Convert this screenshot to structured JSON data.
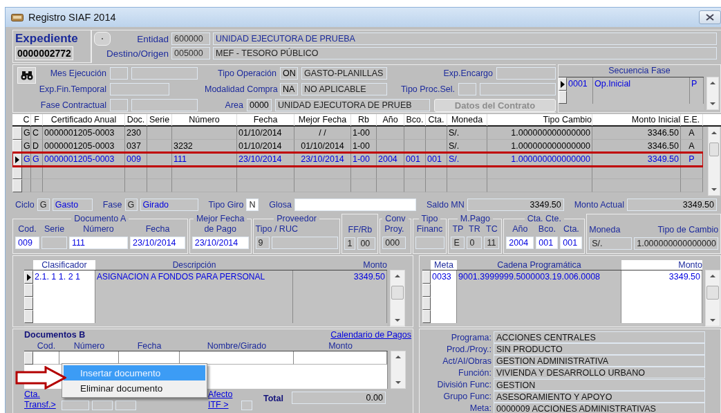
{
  "window": {
    "title": "Registro SIAF 2014"
  },
  "expediente": {
    "label": "Expediente",
    "number": "0000002772"
  },
  "header_fields": [
    {
      "label": "Entidad",
      "code": "600000",
      "value": "UNIDAD EJECUTORA DE PRUEBA"
    },
    {
      "label": "Destino/Origen",
      "code": "005000",
      "value": "MEF - TESORO PÚBLICO"
    }
  ],
  "filter_rows": [
    [
      {
        "kind": "pair",
        "label": "Mes Ejecución"
      },
      {
        "kind": "pair",
        "label": "Tipo Operación",
        "code": "ON",
        "value": "GASTO-PLANILLAS"
      },
      {
        "kind": "single",
        "label": "Exp.Encargo"
      }
    ],
    [
      {
        "kind": "single",
        "label": "Exp.Fin.Temporal"
      },
      {
        "kind": "pair",
        "label": "Modalidad Compra",
        "code": "NA",
        "value": "NO APLICABLE"
      },
      {
        "kind": "pair",
        "label": "Tipo Proc.Sel."
      }
    ],
    [
      {
        "kind": "pair",
        "label": "Fase Contractual"
      },
      {
        "kind": "pair",
        "label": "Area",
        "code": "0000",
        "value": "UNIDAD EJECUTORA DE PRUEB"
      },
      {
        "kind": "button",
        "label": "Datos del Contrato",
        "disabled": true
      }
    ]
  ],
  "fase_sequence": {
    "title": "Secuencia Fase",
    "rows": [
      {
        "cells": [
          "0001",
          "Op.Inicial",
          "P"
        ],
        "selected": true
      }
    ]
  },
  "table": {
    "columns": [
      "C",
      "F",
      "Certificado Anual",
      "Doc.",
      "Serie",
      "Número",
      "Fecha",
      "Mejor Fecha",
      "Rb",
      "Año",
      "Bco.",
      "Cta.",
      "Moneda",
      "Tipo Cambio",
      "Monto Inicial",
      "E.E."
    ],
    "rows": [
      {
        "cells": [
          "G",
          "C",
          "0000001205-0003",
          "230",
          null,
          null,
          "01/10/2014",
          "/ /",
          "1-00",
          null,
          null,
          null,
          "S/.",
          "1.000000000000000",
          "3346.50",
          "A"
        ],
        "selected": false,
        "highlighted": false
      },
      {
        "cells": [
          "G",
          "D",
          "0000001205-0003",
          "037",
          null,
          "3232",
          "01/10/2014",
          "01/10/2014",
          "1-00",
          null,
          null,
          null,
          "S/.",
          "1.000000000000000",
          "3346.50",
          "A"
        ],
        "selected": false,
        "highlighted": false
      },
      {
        "cells": [
          "G",
          "G",
          "0000001205-0003",
          "009",
          null,
          "111",
          "23/10/2014",
          "23/10/2014",
          "1-00",
          "2004",
          "001",
          "001",
          "S/.",
          "1.000000000000000",
          "3349.50",
          "P"
        ],
        "selected": true,
        "highlighted": true
      }
    ]
  },
  "cycle_fields": [
    {
      "label": "Ciclo",
      "fields": [
        {
          "value": "G",
          "editable": false
        },
        {
          "value": "Gasto",
          "editable": false
        }
      ]
    },
    {
      "label": "Fase",
      "fields": [
        {
          "value": "G",
          "editable": false
        },
        {
          "value": "Girado",
          "editable": false
        }
      ]
    },
    {
      "label": "Tipo Giro",
      "fields": [
        {
          "value": "N",
          "editable": true
        }
      ]
    },
    {
      "label": "Glosa",
      "fields": [
        {
          "editable": true
        }
      ]
    },
    {
      "label": "Saldo MN",
      "fields": [
        {
          "value": "3349.50",
          "editable": false
        }
      ]
    },
    {
      "label": "Monto Actual",
      "fields": [
        {
          "value": "3349.50",
          "editable": false
        }
      ]
    }
  ],
  "groups": [
    {
      "legend": "Documento A",
      "labels": [
        "Cod.",
        "Serie",
        "Número",
        "Fecha"
      ],
      "fields": [
        {
          "value": "009",
          "editable": true
        },
        {
          "editable": false
        },
        {
          "value": "111",
          "editable": true
        },
        {
          "value": "23/10/2014",
          "editable": true
        }
      ]
    },
    {
      "legend": "Mejor Fecha",
      "labels": [
        "de Pago"
      ],
      "fields": [
        {
          "value": "23/10/2014",
          "editable": true
        }
      ]
    },
    {
      "legend": "Proveedor",
      "labels": [
        "Tipo / RUC"
      ],
      "fields": [
        {
          "value": "9",
          "editable": false
        },
        {
          "editable": false
        }
      ]
    },
    {
      "labels": [
        "FF/Rb"
      ],
      "fields": [
        {
          "value": "1",
          "editable": false
        },
        {
          "value": "00",
          "editable": false
        }
      ]
    },
    {
      "legend": "Conv",
      "labels": [
        "Proy."
      ],
      "fields": [
        {
          "value": "000",
          "editable": false
        }
      ]
    },
    {
      "legend": "Tipo",
      "labels": [
        "Financ"
      ],
      "fields": [
        {
          "editable": false
        }
      ]
    },
    {
      "legend": "M.Pago",
      "labels": [
        "TP",
        "TR",
        "TC"
      ],
      "fields": [
        {
          "value": "E",
          "editable": false
        },
        {
          "value": "0",
          "editable": false
        },
        {
          "value": "11",
          "editable": false
        }
      ]
    },
    {
      "legend": "Cta. Cte.",
      "labels": [
        "Año",
        "Bco.",
        "Cta."
      ],
      "fields": [
        {
          "value": "2004",
          "editable": true
        },
        {
          "value": "001",
          "editable": true
        },
        {
          "value": "001",
          "editable": true
        }
      ]
    },
    {
      "labels": [
        "Moneda",
        "Tipo de Cambio"
      ],
      "fields": [
        {
          "value": "S/.",
          "editable": false
        },
        {
          "value": "1.000000000000000",
          "editable": false
        }
      ]
    }
  ],
  "classifiers": {
    "columns": [
      "Clasificador",
      "Descripción",
      "Monto"
    ],
    "rows": [
      {
        "cells": [
          "2.1. 1 1. 2 1",
          "ASIGNACION A FONDOS PARA PERSONAL",
          "3349.50"
        ],
        "selected": true
      }
    ]
  },
  "metas": {
    "columns": [
      "Meta",
      "Cadena Programática",
      "Monto"
    ],
    "rows": [
      {
        "cells": [
          "0033",
          "9001.3999999.5000003.19.006.0008",
          "3349.50"
        ],
        "selected": false
      }
    ]
  },
  "documents_b": {
    "title": "Documentos B",
    "link": "Calendario de Pagos",
    "columns": [
      "Cod.",
      "Número",
      "Fecha",
      "Nombre/Girado",
      "Monto"
    ],
    "transfer_link": "Cta. Transf.>",
    "itf_link": "Afecto ITF >",
    "total_label": "Total",
    "total": "0.00"
  },
  "program": [
    {
      "label": "Programa:",
      "value": "ACCIONES CENTRALES"
    },
    {
      "label": "Prod./Proy.:",
      "value": "SIN PRODUCTO"
    },
    {
      "label": "Act/AI/Obras",
      "value": "GESTION ADMINISTRATIVA"
    },
    {
      "label": "Función:",
      "value": "VIVIENDA Y DESARROLLO URBANO"
    },
    {
      "label": "División Func:",
      "value": "GESTION"
    },
    {
      "label": "Grupo Func:",
      "value": "ASESORAMIENTO Y APOYO"
    },
    {
      "label": "Meta:",
      "value": "0000009  ACCIONES ADMINISTRATIVAS"
    }
  ],
  "context_menu": {
    "items": [
      {
        "label": "Insertar documento",
        "selected": true
      },
      {
        "label": "Eliminar documento",
        "selected": false
      }
    ]
  }
}
